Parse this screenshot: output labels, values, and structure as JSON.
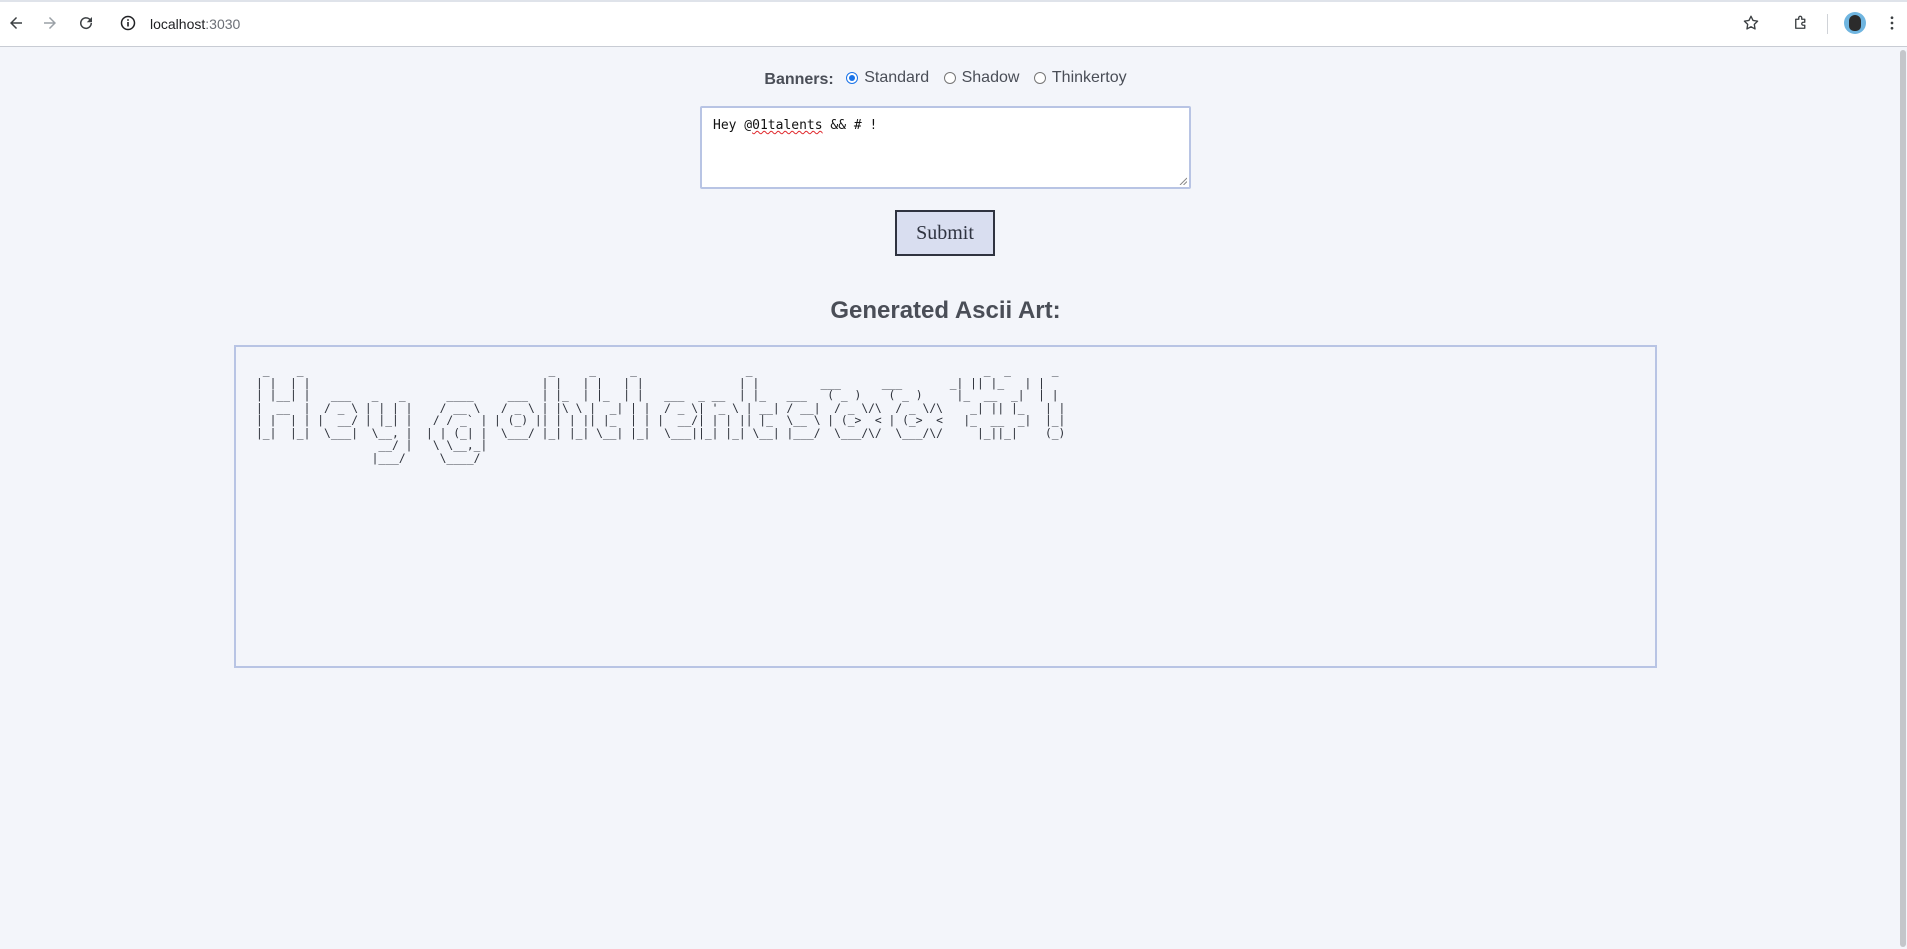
{
  "browser": {
    "url_host": "localhost",
    "url_port": ":3030",
    "icons": [
      "back-icon",
      "forward-icon",
      "reload-icon",
      "site-info-icon",
      "bookmark-star-icon",
      "extensions-icon",
      "profile-avatar-icon",
      "menu-kebab-icon"
    ]
  },
  "banners": {
    "label": "Banners:",
    "options": [
      {
        "label": "Standard",
        "checked": true
      },
      {
        "label": "Shadow",
        "checked": false
      },
      {
        "label": "Thinkertoy",
        "checked": false
      }
    ]
  },
  "input": {
    "value_prefix": "Hey @",
    "value_misspelled": "01talents",
    "value_suffix": " && # !"
  },
  "submit_label": "Submit",
  "result": {
    "heading": "Generated Ascii Art:",
    "ascii_art": " _    _                                    _     _     _                _                                  _  _      _ \n| |  | |                                  | |   | |   | |              | |         ___      ___       _| || |_   | |\n| |__| |   ___   _   _      ____     ___  | |_  | |_  | |   ___  _ __  | |_   ___   ( _ )    ( _ )     |_  __  _|  | |\n|  __  |  / _ \\ | | | |    / __ \\   / _ \\ | |\\ \\ |  _| | |  / _ \\| '_ \\ | __| / __|  / _ \\/\\  / _ \\/\\    _| || |_   | |\n| |  | | |  __/ | |_| |   / / _` | | (_) || | | || |_  | | |  __/| | | || |_  \\__ \\ | (_>  < | (_>  <   |_  __  _|  |_|\n|_|  |_|  \\___|  \\__, |  | | (_| |  \\___/ |_| |_| \\__| |_|  \\___||_| |_| \\__| |___/  \\___/\\/  \\___/\\/     |_||_|    (_)\n                  __/ |   \\ \\__,_|                                                                                      \n                 |___/     \\____/                                                                                       "
  }
}
